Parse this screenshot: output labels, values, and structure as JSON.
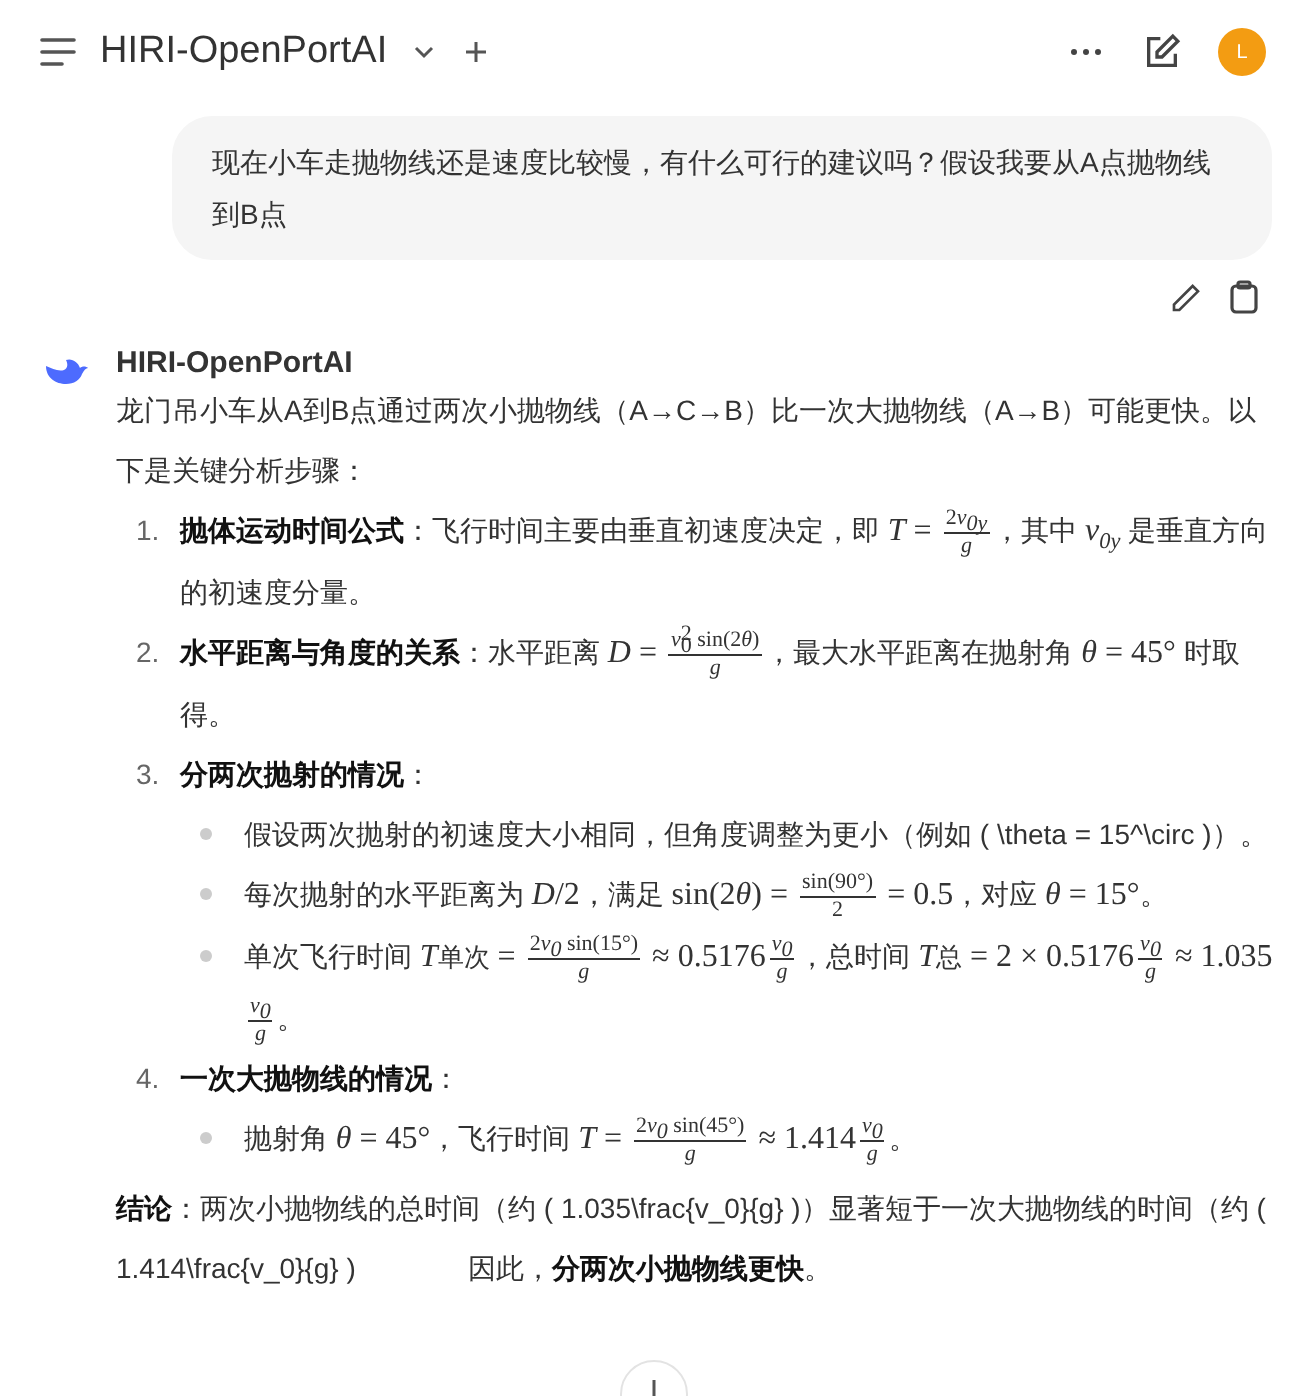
{
  "header": {
    "title": "HIRI-OpenPortAI",
    "avatar": "L"
  },
  "user_message": "现在小车走抛物线还是速度比较慢，有什么可行的建议吗？假设我要从A点抛物线到B点",
  "assistant": {
    "name": "HIRI-OpenPortAI",
    "intro": [
      {
        "kind": "text",
        "text": "龙门吊小车从A到B点通过两次小抛物线（A→C→B）比一次大抛物线（A→B）可能更快。以下是关键分析步骤："
      }
    ],
    "steps": [
      {
        "number": "1.",
        "body": [
          {
            "kind": "bold",
            "text": "抛体运动时间公式"
          },
          {
            "kind": "text",
            "text": "：飞行时间主要由垂直初速度决定，即 "
          },
          {
            "kind": "var",
            "text": "T"
          },
          {
            "kind": "math",
            "text": " = "
          },
          {
            "kind": "frac",
            "num": [
              {
                "kind": "math",
                "text": "2"
              },
              {
                "kind": "var",
                "text": "v",
                "sub": "0y"
              }
            ],
            "den": [
              {
                "kind": "var",
                "text": "g"
              }
            ]
          },
          {
            "kind": "text",
            "text": "，其中 "
          },
          {
            "kind": "var",
            "text": "v",
            "sub": "0y"
          },
          {
            "kind": "text",
            "text": " 是垂直方向的初速度分量。"
          }
        ]
      },
      {
        "number": "2.",
        "body": [
          {
            "kind": "bold",
            "text": "水平距离与角度的关系"
          },
          {
            "kind": "text",
            "text": "：水平距离 "
          },
          {
            "kind": "var",
            "text": "D"
          },
          {
            "kind": "math",
            "text": " = "
          },
          {
            "kind": "frac",
            "num": [
              {
                "kind": "var",
                "text": "v",
                "sub": "0",
                "sup": "2"
              },
              {
                "kind": "math",
                "text": " sin(2"
              },
              {
                "kind": "var",
                "text": "θ"
              },
              {
                "kind": "math",
                "text": ")"
              }
            ],
            "den": [
              {
                "kind": "var",
                "text": "g"
              }
            ]
          },
          {
            "kind": "text",
            "text": "，最大水平距离在抛射角 "
          },
          {
            "kind": "var",
            "text": "θ"
          },
          {
            "kind": "math",
            "text": " = 45°"
          },
          {
            "kind": "text",
            "text": " 时取得。"
          }
        ]
      },
      {
        "number": "3.",
        "body": [
          {
            "kind": "bold",
            "text": "分两次抛射的情况"
          },
          {
            "kind": "text",
            "text": "："
          }
        ],
        "bullets": [
          [
            {
              "kind": "text",
              "text": "假设两次抛射的初速度大小相同，但角度调整为更小（例如 ( \\theta = 15^\\circ )）。"
            }
          ],
          [
            {
              "kind": "text",
              "text": "每次抛射的水平距离为 "
            },
            {
              "kind": "var",
              "text": "D"
            },
            {
              "kind": "math",
              "text": "/2"
            },
            {
              "kind": "text",
              "text": "，满足 "
            },
            {
              "kind": "math",
              "text": "sin(2"
            },
            {
              "kind": "var",
              "text": "θ"
            },
            {
              "kind": "math",
              "text": ") = "
            },
            {
              "kind": "frac",
              "num": [
                {
                  "kind": "math",
                  "text": "sin(90°)"
                }
              ],
              "den": [
                {
                  "kind": "math",
                  "text": "2"
                }
              ]
            },
            {
              "kind": "math",
              "text": " = 0.5"
            },
            {
              "kind": "text",
              "text": "，对应 "
            },
            {
              "kind": "var",
              "text": "θ"
            },
            {
              "kind": "math",
              "text": " = 15°"
            },
            {
              "kind": "text",
              "text": "。"
            }
          ],
          [
            {
              "kind": "text",
              "text": "单次飞行时间 "
            },
            {
              "kind": "var",
              "text": "T"
            },
            {
              "kind": "small",
              "text": "单次"
            },
            {
              "kind": "math",
              "text": " = "
            },
            {
              "kind": "frac",
              "num": [
                {
                  "kind": "math",
                  "text": "2"
                },
                {
                  "kind": "var",
                  "text": "v",
                  "sub": "0"
                },
                {
                  "kind": "math",
                  "text": " sin(15°)"
                }
              ],
              "den": [
                {
                  "kind": "var",
                  "text": "g"
                }
              ]
            },
            {
              "kind": "math",
              "text": " ≈ 0.5176"
            },
            {
              "kind": "frac",
              "num": [
                {
                  "kind": "var",
                  "text": "v",
                  "sub": "0"
                }
              ],
              "den": [
                {
                  "kind": "var",
                  "text": "g"
                }
              ]
            },
            {
              "kind": "text",
              "text": "，总时间 "
            },
            {
              "kind": "var",
              "text": "T"
            },
            {
              "kind": "small",
              "text": "总"
            },
            {
              "kind": "math",
              "text": " = 2 × 0.5176"
            },
            {
              "kind": "frac",
              "num": [
                {
                  "kind": "var",
                  "text": "v",
                  "sub": "0"
                }
              ],
              "den": [
                {
                  "kind": "var",
                  "text": "g"
                }
              ]
            },
            {
              "kind": "math",
              "text": " ≈ 1.035"
            },
            {
              "kind": "frac",
              "num": [
                {
                  "kind": "var",
                  "text": "v",
                  "sub": "0"
                }
              ],
              "den": [
                {
                  "kind": "var",
                  "text": "g"
                }
              ]
            },
            {
              "kind": "text",
              "text": "。"
            }
          ]
        ]
      },
      {
        "number": "4.",
        "body": [
          {
            "kind": "bold",
            "text": "一次大抛物线的情况"
          },
          {
            "kind": "text",
            "text": "："
          }
        ],
        "bullets": [
          [
            {
              "kind": "text",
              "text": "抛射角 "
            },
            {
              "kind": "var",
              "text": "θ"
            },
            {
              "kind": "math",
              "text": " = 45°"
            },
            {
              "kind": "text",
              "text": "，飞行时间 "
            },
            {
              "kind": "var",
              "text": "T"
            },
            {
              "kind": "math",
              "text": " = "
            },
            {
              "kind": "frac",
              "num": [
                {
                  "kind": "math",
                  "text": "2"
                },
                {
                  "kind": "var",
                  "text": "v",
                  "sub": "0"
                },
                {
                  "kind": "math",
                  "text": " sin(45°)"
                }
              ],
              "den": [
                {
                  "kind": "var",
                  "text": "g"
                }
              ]
            },
            {
              "kind": "math",
              "text": " ≈ 1.414"
            },
            {
              "kind": "frac",
              "num": [
                {
                  "kind": "var",
                  "text": "v",
                  "sub": "0"
                }
              ],
              "den": [
                {
                  "kind": "var",
                  "text": "g"
                }
              ]
            },
            {
              "kind": "text",
              "text": "。"
            }
          ]
        ]
      }
    ],
    "conclusion_before": [
      {
        "kind": "bold",
        "text": "结论"
      },
      {
        "kind": "text",
        "text": "：两次小抛物线的总时间（约 ( 1.035\\frac{v_0}{g} )）显著短于一次大抛物线的时间（约 ( 1.414\\frac{v_0}{g} )"
      }
    ],
    "conclusion_after": [
      {
        "kind": "text",
        "text": "因此，"
      },
      {
        "kind": "bold",
        "text": "分两次小抛物线更快"
      },
      {
        "kind": "text",
        "text": "。"
      }
    ]
  }
}
